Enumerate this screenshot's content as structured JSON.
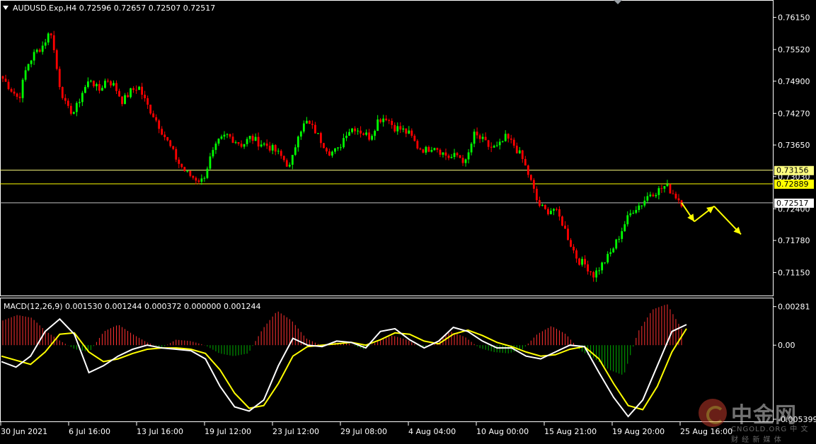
{
  "window": {
    "symbol_info": "AUDUSD.Exp,H4  0.72596 0.72657 0.72507 0.72517",
    "menu_icon": "triangle-down-icon"
  },
  "price_panel": {
    "y_ticks": [
      "0.76150",
      "0.75520",
      "0.74900",
      "0.74270",
      "0.73650",
      "0.73030",
      "0.72400",
      "0.71780",
      "0.71150"
    ],
    "level_lines": [
      {
        "value": 0.73156,
        "label": "0.73156",
        "color": "#ffff80"
      },
      {
        "value": 0.72889,
        "label": "0.72889",
        "color": "#ffff00"
      }
    ],
    "current_price": {
      "value": 0.72517,
      "label": "0.72517"
    },
    "colors": {
      "bull": "#00ff00",
      "bear": "#ff0000",
      "arrow": "#ffff00",
      "line": "#ffff80"
    }
  },
  "macd_panel": {
    "title": "MACD(12,26,9) 0.001530 0.001244 0.000372 0.000000 0.001244",
    "y_ticks": [
      "0.00281",
      "0.00",
      "-0.005399"
    ]
  },
  "x_ticks": [
    "30 Jun 2021",
    "6 Jul 16:00",
    "13 Jul 16:00",
    "19 Jul 12:00",
    "23 Jul 12:00",
    "29 Jul 08:00",
    "4 Aug 04:00",
    "10 Aug 00:00",
    "15 Aug 21:00",
    "19 Aug 20:00",
    "25 Aug 16:00"
  ],
  "watermark": {
    "cn": "中金网",
    "en": "CNGOLD.ORG  中 文 财 经 新 媒 体"
  },
  "chart_data": {
    "type": "candlestick",
    "title": "AUDUSD.Exp,H4",
    "ylim": [
      0.7095,
      0.7638
    ],
    "close_path": [
      0.7495,
      0.7475,
      0.7455,
      0.752,
      0.7545,
      0.756,
      0.759,
      0.749,
      0.7435,
      0.743,
      0.747,
      0.7495,
      0.747,
      0.7495,
      0.748,
      0.745,
      0.747,
      0.748,
      0.7445,
      0.742,
      0.739,
      0.736,
      0.733,
      0.731,
      0.73,
      0.7295,
      0.734,
      0.737,
      0.7385,
      0.7375,
      0.7365,
      0.738,
      0.737,
      0.7365,
      0.7355,
      0.734,
      0.732,
      0.739,
      0.741,
      0.7395,
      0.737,
      0.735,
      0.7355,
      0.739,
      0.74,
      0.739,
      0.738,
      0.7415,
      0.742,
      0.74,
      0.7395,
      0.7385,
      0.736,
      0.7355,
      0.7365,
      0.735,
      0.734,
      0.7345,
      0.733,
      0.7385,
      0.7375,
      0.736,
      0.736,
      0.738,
      0.7365,
      0.734,
      0.73,
      0.725,
      0.7235,
      0.724,
      0.7215,
      0.7175,
      0.714,
      0.713,
      0.711,
      0.713,
      0.715,
      0.718,
      0.7215,
      0.724,
      0.725,
      0.727,
      0.7275,
      0.7285,
      0.727,
      0.7252
    ],
    "macd_line": [
      -0.0012,
      -0.0016,
      -0.0008,
      0.001,
      0.0019,
      0.0008,
      -0.002,
      -0.0015,
      -0.0008,
      -0.0003,
      0.0,
      -0.0002,
      -0.0003,
      -0.0004,
      -0.001,
      -0.003,
      -0.0045,
      -0.0048,
      -0.004,
      -0.0015,
      0.0005,
      0.0,
      -0.0001,
      0.0003,
      0.0002,
      -0.0002,
      0.001,
      0.0012,
      0.0004,
      -0.0002,
      0.0003,
      0.0013,
      0.001,
      0.0003,
      -0.0002,
      -0.0002,
      -0.0008,
      -0.001,
      -0.0005,
      0.0,
      -0.0001,
      -0.002,
      -0.0038,
      -0.0052,
      -0.004,
      -0.0015,
      0.001,
      0.0015
    ],
    "signal_line": [
      -0.0008,
      -0.0011,
      -0.0014,
      -0.0005,
      0.0008,
      0.0009,
      -0.0005,
      -0.0012,
      -0.001,
      -0.0006,
      -0.0003,
      -0.0002,
      -0.0002,
      -0.0003,
      -0.0006,
      -0.0018,
      -0.0035,
      -0.0046,
      -0.0044,
      -0.0028,
      -0.0008,
      -0.0001,
      0.0,
      0.0001,
      0.0002,
      0.0,
      0.0004,
      0.0009,
      0.0008,
      0.0003,
      0.0001,
      0.0008,
      0.0011,
      0.0007,
      0.0002,
      -0.0001,
      -0.0005,
      -0.0008,
      -0.0007,
      -0.0003,
      -0.0001,
      -0.001,
      -0.0028,
      -0.0044,
      -0.0047,
      -0.003,
      -0.0005,
      0.0012
    ],
    "histogram": [
      0.0018,
      0.0022,
      0.002,
      0.001,
      0.0003,
      -0.0003,
      -0.0005,
      0.001,
      0.0015,
      0.0008,
      0.0002,
      -0.0002,
      0.0004,
      0.0003,
      0.0,
      -0.0006,
      -0.0008,
      -0.0006,
      0.0012,
      0.0025,
      0.0018,
      0.0005,
      0.0,
      0.0002,
      0.0001,
      -0.0003,
      0.0003,
      0.0007,
      0.0004,
      -0.0002,
      0.0002,
      0.001,
      0.0006,
      -0.0002,
      -0.0005,
      -0.0006,
      -0.0003,
      0.0008,
      0.0014,
      0.0008,
      -0.0004,
      -0.001,
      -0.0018,
      -0.0022,
      0.001,
      0.0026,
      0.003,
      0.0012
    ],
    "macd_ylim": [
      -0.0054,
      0.003
    ],
    "forecast_arrows": [
      [
        0.7252,
        0.7215
      ],
      [
        0.7215,
        0.7245
      ],
      [
        0.7245,
        0.719
      ]
    ],
    "grid": false
  }
}
